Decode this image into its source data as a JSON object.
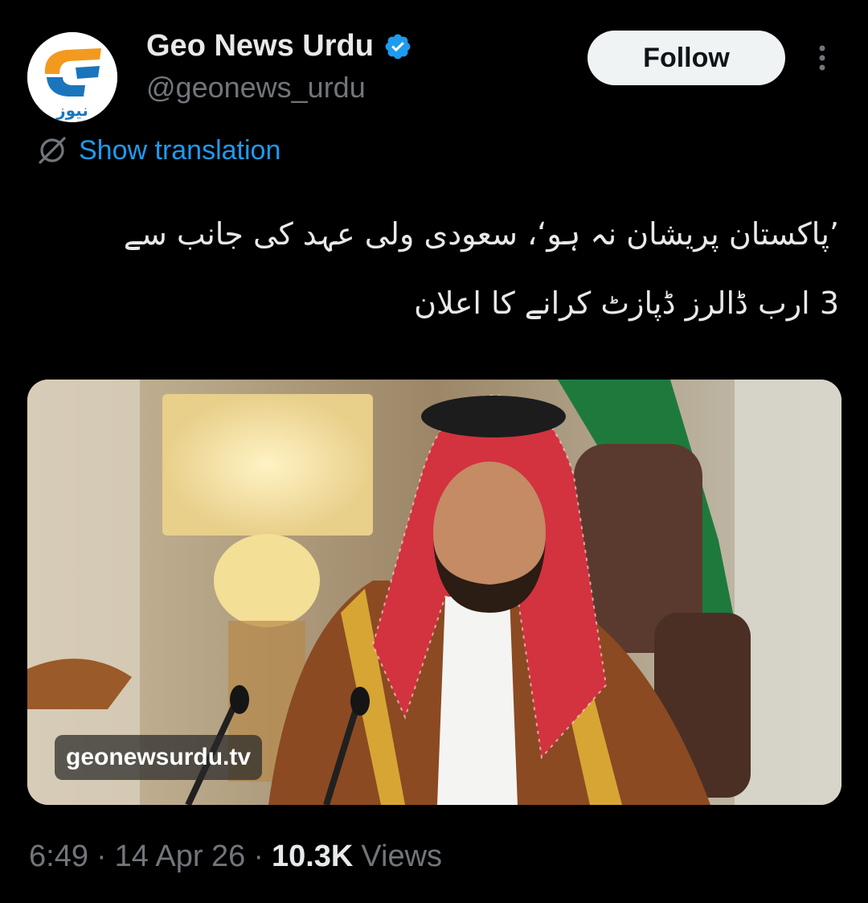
{
  "author": {
    "name": "Geo News Urdu",
    "handle": "@geonews_urdu",
    "verified": true,
    "avatar_logo_text": "نیوز"
  },
  "follow_label": "Follow",
  "show_translation_label": "Show translation",
  "tweet": {
    "line1": "’پاکستان پریشان نہ ہو‘، سعودی ولی عہد کی جانب سے",
    "line2": "3 ارب ڈالرز ڈپازٹ کرانے کا اعلان"
  },
  "media": {
    "watermark": "geonewsurdu.tv"
  },
  "meta": {
    "time": "6:49",
    "separator": "·",
    "date": "14 Apr 26",
    "views_count": "10.3K",
    "views_label": "Views"
  },
  "colors": {
    "background": "#000000",
    "accent": "#1d9bf0",
    "text_primary": "#e7e9ea",
    "text_secondary": "#71767b",
    "follow_bg": "#eff3f4"
  },
  "icons": [
    "verified-badge-icon",
    "translate-icon",
    "more-icon"
  ]
}
